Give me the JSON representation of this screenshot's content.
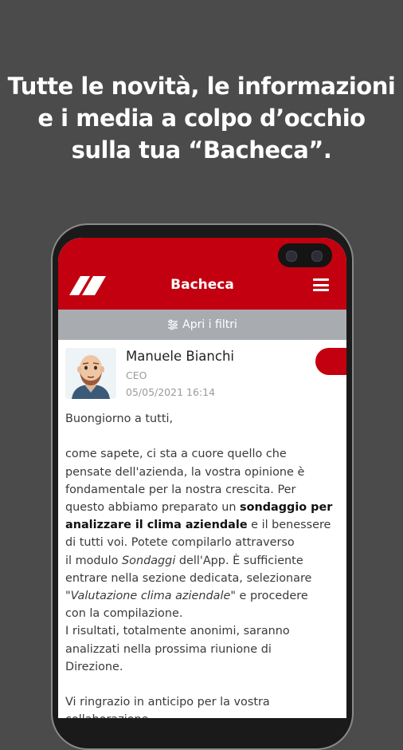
{
  "headline": {
    "line1": "Tutte le novità, le informazioni",
    "line2": "e i media a colpo d’occhio",
    "line3": "sulla tua “Bacheca”."
  },
  "appbar": {
    "title": "Bacheca",
    "menu_icon": "hamburger-menu-icon",
    "logo": "app-logo",
    "accent": "#c3000f"
  },
  "filterbar": {
    "label": "Apri i filtri",
    "icon": "sliders-icon"
  },
  "post": {
    "author": "Manuele Bianchi",
    "role": "CEO",
    "date": "05/05/2021 16:14",
    "body": {
      "greeting": "Buongiorno a tutti,",
      "l1": "come sapete, ci sta a cuore quello che",
      "l2": "pensate dell'azienda, la vostra opinione è",
      "l3": "fondamentale per la nostra crescita. Per",
      "l4a": "questo abbiamo preparato un ",
      "l4b": "sondaggio per",
      "l5a": "analizzare il clima aziendale",
      "l5b": " e il benessere",
      "l6": "di tutti voi. Potete compilarlo attraverso",
      "l7a": "il modulo ",
      "l7b": "Sondaggi",
      "l7c": " dell'App. È sufficiente",
      "l8": "entrare nella sezione dedicata, selezionare",
      "l9a": " \"",
      "l9b": "Valutazione clima aziendale",
      "l9c": "\" e procedere",
      "l10": "con la compilazione.",
      "l11": "I risultati, totalmente anonimi, saranno",
      "l12": "analizzati nella prossima riunione di",
      "l13": "Direzione.",
      "l14": "Vi ringrazio in anticipo per la vostra",
      "l15": "collaborazione."
    }
  }
}
